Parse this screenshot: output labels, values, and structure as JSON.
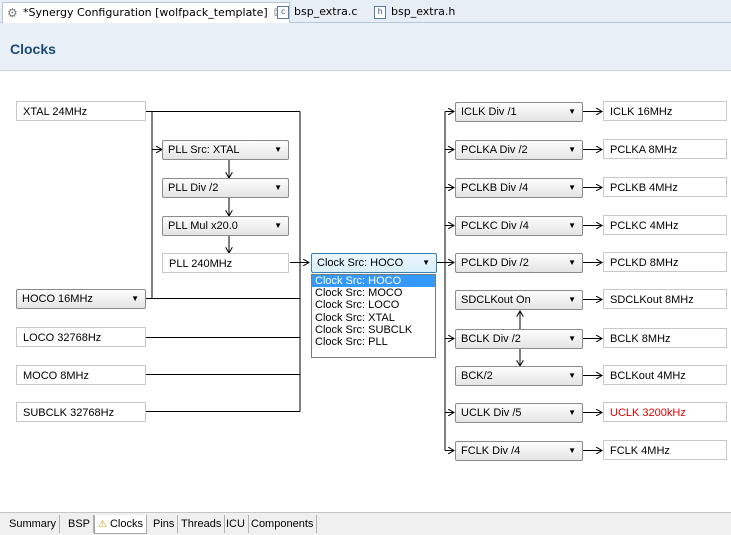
{
  "editor_tabs": [
    {
      "label": "*Synergy Configuration [wolfpack_template]",
      "icon": "gear-icon",
      "close": "☒"
    },
    {
      "label": "bsp_extra.c",
      "icon": "c"
    },
    {
      "label": "bsp_extra.h",
      "icon": "h"
    }
  ],
  "page": {
    "title": "Clocks"
  },
  "sources": {
    "xtal": "XTAL 24MHz",
    "hoco": "HOCO 16MHz",
    "loco": "LOCO 32768Hz",
    "moco": "MOCO 8MHz",
    "subclk": "SUBCLK 32768Hz"
  },
  "pll": {
    "src": "PLL Src: XTAL",
    "div": "PLL Div /2",
    "mul": "PLL Mul x20.0",
    "out": "PLL 240MHz"
  },
  "clock_src": {
    "selected": "Clock Src: HOCO",
    "options": [
      "Clock Src: HOCO",
      "Clock Src: MOCO",
      "Clock Src: LOCO",
      "Clock Src: XTAL",
      "Clock Src: SUBCLK",
      "Clock Src: PLL"
    ]
  },
  "dividers": [
    {
      "label": "ICLK Div /1",
      "out": "ICLK 16MHz",
      "out_color": "#000000"
    },
    {
      "label": "PCLKA Div /2",
      "out": "PCLKA 8MHz",
      "out_color": "#000000"
    },
    {
      "label": "PCLKB Div /4",
      "out": "PCLKB 4MHz",
      "out_color": "#000000"
    },
    {
      "label": "PCLKC Div /4",
      "out": "PCLKC 4MHz",
      "out_color": "#000000"
    },
    {
      "label": "PCLKD Div /2",
      "out": "PCLKD 8MHz",
      "out_color": "#000000"
    },
    {
      "label": "SDCLKout On",
      "out": "SDCLKout 8MHz",
      "out_color": "#000000"
    },
    {
      "label": "BCLK Div /2",
      "out": "BCLK 8MHz",
      "out_color": "#000000"
    },
    {
      "label": "BCK/2",
      "out": "BCLKout 4MHz",
      "out_color": "#000000"
    },
    {
      "label": "UCLK Div /5",
      "out": "UCLK 3200kHz",
      "out_color": "#e00000"
    },
    {
      "label": "FCLK Div /4",
      "out": "FCLK 4MHz",
      "out_color": "#000000"
    }
  ],
  "bottom_tabs": [
    "Summary",
    "BSP",
    "Clocks",
    "Pins",
    "Threads",
    "ICU",
    "Components"
  ],
  "active_bottom_tab": "Clocks"
}
